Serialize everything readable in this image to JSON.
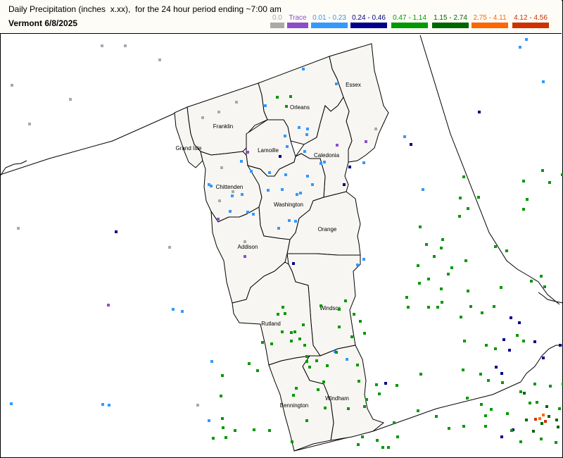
{
  "header": {
    "title": "Daily Precipitation (inches  x.xx),  for the 24 hour period ending ~7:00 am",
    "subtitle": "Vermont 6/8/2025"
  },
  "legend": [
    {
      "label": "0.0",
      "color": "#a9a9a9"
    },
    {
      "label": "Trace",
      "color": "#8a4fc8"
    },
    {
      "label": "0.01 - 0.23",
      "color": "#3399ff"
    },
    {
      "label": "0.24 - 0.46",
      "color": "#000088"
    },
    {
      "label": "0.47 - 1.14",
      "color": "#009900"
    },
    {
      "label": "1.15 - 2.74",
      "color": "#006600"
    },
    {
      "label": "2.75 - 4.11",
      "color": "#ff6600"
    },
    {
      "label": "4.12 - 4.56",
      "color": "#cc3300"
    }
  ],
  "counties": [
    {
      "name": "Essex"
    },
    {
      "name": "Orleans"
    },
    {
      "name": "Franklin"
    },
    {
      "name": "Grand Isle"
    },
    {
      "name": "Lamoille"
    },
    {
      "name": "Caledonia"
    },
    {
      "name": "Chittenden"
    },
    {
      "name": "Washington"
    },
    {
      "name": "Orange"
    },
    {
      "name": "Addison"
    },
    {
      "name": "Windsor"
    },
    {
      "name": "Rutland"
    },
    {
      "name": "Windham"
    },
    {
      "name": "Bennington"
    }
  ]
}
